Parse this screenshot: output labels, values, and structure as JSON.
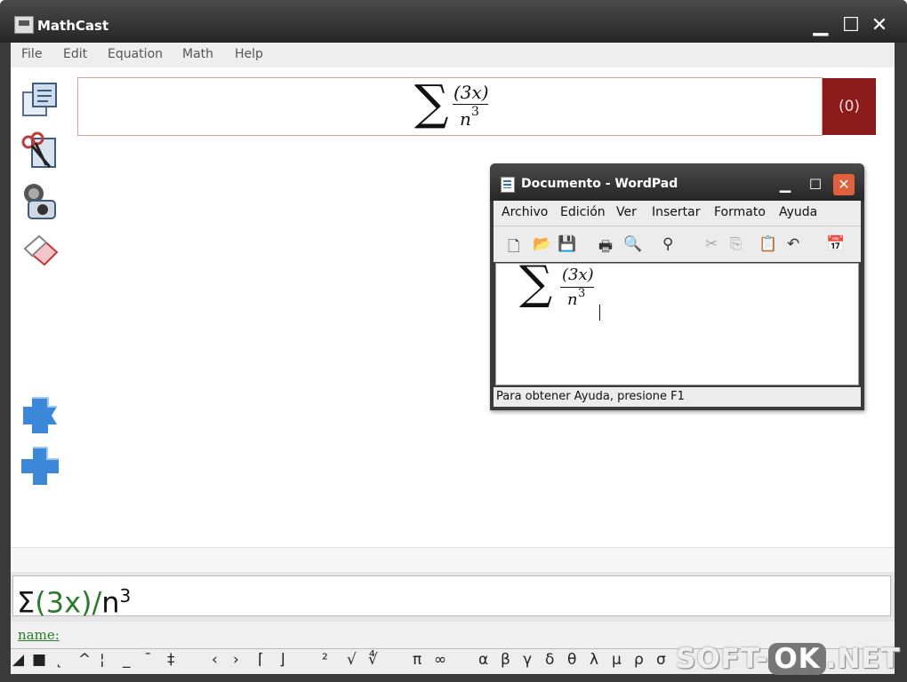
{
  "window": {
    "title": "MathCast",
    "min": "▁",
    "max": "☐",
    "close": "✕"
  },
  "menu": [
    "File",
    "Edit",
    "Equation",
    "Math",
    "Help"
  ],
  "display": {
    "sum": "∑",
    "numerator": "(3x)",
    "denominator": "n",
    "exponent": "3",
    "counter": "(0)"
  },
  "input": {
    "sigma": "Σ",
    "open": "(3x)",
    "slash": "/",
    "base": "n",
    "exp": "3"
  },
  "name_label": "name:",
  "symbols": [
    "◢",
    "■",
    "˛",
    "^",
    "¦",
    "_",
    "¯",
    "‡",
    "‹",
    "›",
    "⌈",
    "⌋",
    "²",
    "√",
    "∜",
    "π",
    "∞",
    "α",
    "β",
    "γ",
    "δ",
    "θ",
    "λ",
    "μ",
    "ρ",
    "σ"
  ],
  "wordpad": {
    "title": "Documento - WordPad",
    "menu": [
      "Archivo",
      "Edición",
      "Ver",
      "Insertar",
      "Formato",
      "Ayuda"
    ],
    "status": "Para obtener Ayuda, presione F1",
    "sum": "∑",
    "numerator": "(3x)",
    "denominator": "n",
    "exponent": "3"
  },
  "watermark": {
    "a": "SOFT",
    "b": "OK",
    "c": ".NET"
  },
  "colors": {
    "counter_bg": "#8b1a1a",
    "accent_green": "#2d7a2d",
    "tool_blue": "#3b88d8"
  }
}
